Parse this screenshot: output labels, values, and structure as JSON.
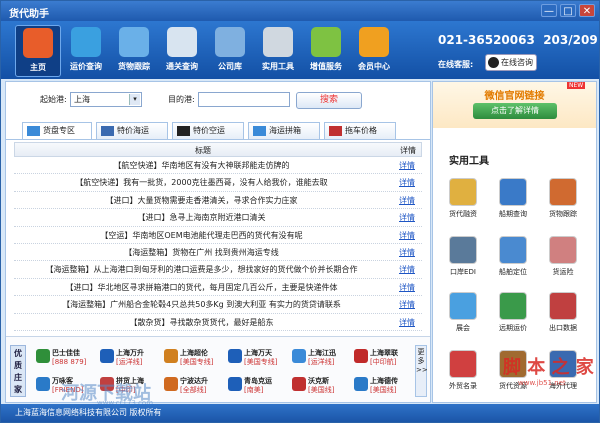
{
  "window": {
    "title": "货代助手",
    "min": "—",
    "max": "□",
    "close": "✕"
  },
  "toolbar": {
    "items": [
      {
        "label": "主页",
        "icon": "home-icon",
        "color": "#e85d2a"
      },
      {
        "label": "运价查询",
        "icon": "globe-icon",
        "color": "#3aa0e0"
      },
      {
        "label": "货物跟踪",
        "icon": "ship-icon",
        "color": "#6ab0e8"
      },
      {
        "label": "通关查询",
        "icon": "satellite-icon",
        "color": "#d8e4f0"
      },
      {
        "label": "公司库",
        "icon": "buildings-icon",
        "color": "#7fb0e0"
      },
      {
        "label": "实用工具",
        "icon": "tools-icon",
        "color": "#d0d8e0"
      },
      {
        "label": "增值服务",
        "icon": "android-icon",
        "color": "#7ec242"
      },
      {
        "label": "会员中心",
        "icon": "vip-icon",
        "color": "#f0a020"
      }
    ],
    "phone": "021-36520063",
    "counter": "203/209",
    "online_label": "在线客服:",
    "qq_button": "在线咨询"
  },
  "search": {
    "from_label": "起始港:",
    "from_value": "上海",
    "to_label": "目的港:",
    "to_value": "",
    "button": "搜索"
  },
  "tabs": [
    {
      "label": "货盘专区",
      "icon": "globe-icon",
      "color": "#3a8ad8"
    },
    {
      "label": "特价海运",
      "icon": "ship-icon",
      "color": "#3a6ab0"
    },
    {
      "label": "特价空运",
      "icon": "plane-icon",
      "color": "#222"
    },
    {
      "label": "海运拼箱",
      "icon": "container-icon",
      "color": "#3a8ad8"
    },
    {
      "label": "拖车价格",
      "icon": "truck-icon",
      "color": "#c03030"
    }
  ],
  "table": {
    "col_title": "标题",
    "col_detail": "详情",
    "rows": [
      {
        "title": "【航空快递】华南地区有没有大神联邦能走仿牌的",
        "detail": "详情"
      },
      {
        "title": "【航空快递】我有一批货，2000克往墨西哥，没有人给我价，谁能去取",
        "detail": "详情"
      },
      {
        "title": "【进口】大量货物需要走香港清关，寻求合作实力庄家",
        "detail": "详情"
      },
      {
        "title": "【进口】急寻上海南京附近港口清关",
        "detail": "详情"
      },
      {
        "title": "【空运】华南地区OEM电池能代理走巴西的货代有没有呢",
        "detail": "详情"
      },
      {
        "title": "【海运整箱】货物在广州 找到贵州海运专线",
        "detail": "详情"
      },
      {
        "title": "【海运整箱】从上海港口到匈牙利的港口运费是多少，想找家好的货代做个价并长期合作",
        "detail": "详情"
      },
      {
        "title": "【进口】华北地区寻求拼箱港口的货代，每月固定几百公斤，主要是快递件体",
        "detail": "详情"
      },
      {
        "title": "【海运整箱】广州船合金轮毂4只总共50多Kg 到澳大利亚 有实力的货贷请联系",
        "detail": "详情"
      },
      {
        "title": "【散杂货】寻找散杂货货代，最好是船东",
        "detail": "详情"
      }
    ]
  },
  "companies": {
    "side_label": "优质庄家",
    "more_label": "更多>>",
    "items": [
      {
        "name": "巴士佳佳",
        "tag": "[888 879]",
        "color": "#2f8f3a"
      },
      {
        "name": "上海万升",
        "tag": "[运洋线]",
        "color": "#1e5fb8"
      },
      {
        "name": "上海超伦",
        "tag": "[美国专线]",
        "color": "#d08020"
      },
      {
        "name": "上海万天",
        "tag": "[美国专线]",
        "color": "#1e5fb8"
      },
      {
        "name": "上海江迅",
        "tag": "[运洋线]",
        "color": "#3a8ad8"
      },
      {
        "name": "上海翠联",
        "tag": "[中印航]",
        "color": "#c02a2a"
      },
      {
        "name": "万咏客",
        "tag": "[FRIEND]",
        "color": "#2a7ac8"
      },
      {
        "name": "拼货上海",
        "tag": "[中印]",
        "color": "#c04040"
      },
      {
        "name": "宁波达升",
        "tag": "[全部线]",
        "color": "#d06a20"
      },
      {
        "name": "青岛克运",
        "tag": "[南美]",
        "color": "#1e5fb8"
      },
      {
        "name": "沃克斯",
        "tag": "[美国线]",
        "color": "#c03030"
      },
      {
        "name": "上海德传",
        "tag": "[美国线]",
        "color": "#2a7ac8"
      }
    ]
  },
  "promo": {
    "title": "微信官网链接",
    "button": "点击了解详情",
    "badge": "NEW"
  },
  "tools": {
    "heading": "实用工具",
    "items": [
      {
        "label": "货代融资",
        "icon": "money-icon",
        "color": "#e0b040"
      },
      {
        "label": "船期查询",
        "icon": "cargo-ship-icon",
        "color": "#3a7ac8"
      },
      {
        "label": "货物跟踪",
        "icon": "pin-icon",
        "color": "#d06a30"
      },
      {
        "label": "口岸EDI",
        "icon": "anchor-icon",
        "color": "#5a7a9a"
      },
      {
        "label": "船舶定位",
        "icon": "satellite-dish-icon",
        "color": "#4a8ad0"
      },
      {
        "label": "货运险",
        "icon": "umbrella-icon",
        "color": "#d08080"
      },
      {
        "label": "展会",
        "icon": "ball-icon",
        "color": "#4aa0e0"
      },
      {
        "label": "远期运价",
        "icon": "chart-icon",
        "color": "#3a9a4a"
      },
      {
        "label": "出口数据",
        "icon": "bar-chart-icon",
        "color": "#c04040"
      },
      {
        "label": "外贸名录",
        "icon": "book-icon",
        "color": "#d04040"
      },
      {
        "label": "货代资源",
        "icon": "boxes-icon",
        "color": "#a06a30"
      },
      {
        "label": "海外代理",
        "icon": "world-icon",
        "color": "#3a6ab0"
      }
    ]
  },
  "watermarks": {
    "right": "脚 本 之 家",
    "right_url": "www.jb51.net",
    "left": "河源下载站",
    "left_url": "www.cr173.com"
  },
  "status": {
    "text": "上海蓝海信息网络科技有限公司  版权所有"
  }
}
